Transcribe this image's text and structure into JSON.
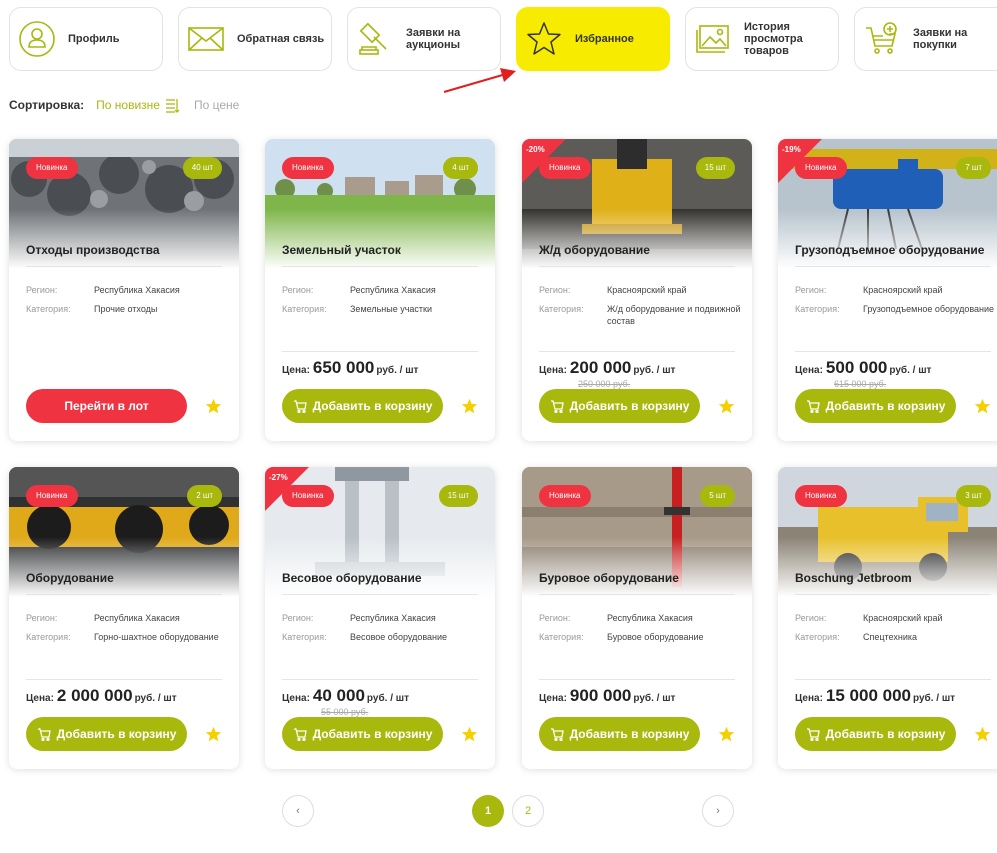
{
  "tabs": [
    {
      "label": "Профиль",
      "icon": "profile-icon"
    },
    {
      "label": "Обратная связь",
      "icon": "envelope-icon"
    },
    {
      "label": "Заявки на\nаукционы",
      "icon": "gavel-icon"
    },
    {
      "label": "Избранное",
      "icon": "star-outline-icon",
      "active": true
    },
    {
      "label": "История\nпросмотра\nтоваров",
      "icon": "image-history-icon"
    },
    {
      "label": "Заявки на\nпокупки",
      "icon": "cart-add-icon"
    }
  ],
  "sort": {
    "label": "Сортировка:",
    "active": "По новизне",
    "other": "По цене"
  },
  "labels": {
    "region": "Регион:",
    "category": "Категория:",
    "price": "Цена:",
    "new": "Новинка",
    "unit": "руб. / шт"
  },
  "cards": [
    {
      "title": "Отходы производства",
      "qty": "40 шт",
      "discount": "",
      "region": "Республика Хакасия",
      "category": "Прочие отходы",
      "price": "",
      "old_price": "",
      "button": "Перейти в лот",
      "image": "scrap-metal"
    },
    {
      "title": "Земельный участок",
      "qty": "4 шт",
      "discount": "",
      "region": "Республика Хакасия",
      "category": "Земельные участки",
      "price": "650 000",
      "old_price": "",
      "button": "Добавить в корзину",
      "image": "land-plot"
    },
    {
      "title": "Ж/д оборудование",
      "qty": "15 шт",
      "discount": "-20%",
      "region": "Красноярский край",
      "category": "Ж/д оборудование и подвижной состав",
      "price": "200 000",
      "old_price": "250 000 руб.",
      "button": "Добавить в корзину",
      "image": "rail-machine"
    },
    {
      "title": "Грузоподъемное оборудование",
      "qty": "7 шт",
      "discount": "-19%",
      "region": "Красноярский край",
      "category": "Грузоподъемное оборудование",
      "price": "500 000",
      "old_price": "615 000 руб.",
      "button": "Добавить в корзину",
      "image": "crane-hoist"
    },
    {
      "title": "Оборудование",
      "qty": "2 шт",
      "discount": "",
      "region": "Республика Хакасия",
      "category": "Горно-шахтное оборудование",
      "price": "2 000 000",
      "old_price": "",
      "button": "Добавить в корзину",
      "image": "mining-cutter"
    },
    {
      "title": "Весовое оборудование",
      "qty": "15 шт",
      "discount": "-27%",
      "region": "Республика Хакасия",
      "category": "Весовое оборудование",
      "price": "40 000",
      "old_price": "55 000 руб.",
      "button": "Добавить в корзину",
      "image": "scale"
    },
    {
      "title": "Буровое оборудование",
      "qty": "5 шт",
      "discount": "",
      "region": "Республика Хакасия",
      "category": "Буровое оборудование",
      "price": "900 000",
      "old_price": "",
      "button": "Добавить в корзину",
      "image": "drill-rig"
    },
    {
      "title": "Boschung Jetbroom",
      "qty": "3 шт",
      "discount": "",
      "region": "Красноярский край",
      "category": "Спецтехника",
      "price": "15 000 000",
      "old_price": "",
      "button": "Добавить в корзину",
      "image": "yellow-truck"
    }
  ],
  "pagination": {
    "pages": [
      "1",
      "2"
    ],
    "current": "1",
    "prev": "‹",
    "next": "›"
  },
  "colors": {
    "accent": "#a8b80c",
    "active_tab": "#f7ec00",
    "red": "#ef3340",
    "star": "#f5d000"
  }
}
